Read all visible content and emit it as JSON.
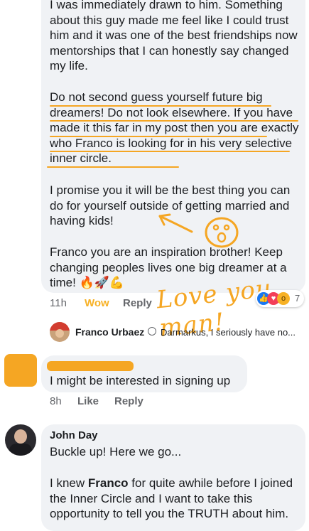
{
  "post_comment": {
    "paragraphs": [
      "I was immediately drawn to him. Something about this guy made me feel like I could trust him and it was one of the best friendships now mentorships that I can honestly say changed my life.",
      "Do not second guess yourself future big dreamers! Do not look elsewhere. If you have made it this far in my post then you are exactly who Franco is looking for in his very selective inner circle.",
      "I promise you it will be the best thing you can do for yourself outside of getting married and having kids!",
      "Franco you are an inspiration brother! Keep changing peoples lives one big dreamer at a time! 🔥🚀💪"
    ],
    "time": "11h",
    "reaction_label": "Wow",
    "reply_label": "Reply",
    "reaction_count": "7",
    "handwritten_annotation": "Love you man!"
  },
  "reply_preview": {
    "author": "Franco Urbaez",
    "text": "Darmarkus, I seriously have no..."
  },
  "comment2": {
    "text": "I might be interested in signing up",
    "time": "8h",
    "like_label": "Like",
    "reply_label": "Reply"
  },
  "comment3": {
    "author": "John Day",
    "line1": "Buckle up! Here we go...",
    "line2_pre": "I knew ",
    "line2_bold": "Franco",
    "line2_post": " for quite awhile before I joined the Inner Circle and I want to take this opportunity to tell you the TRUTH about him."
  },
  "colors": {
    "bubble": "#f0f2f5",
    "annotation": "#f5a623",
    "wow": "#f7b125",
    "meta": "#65676b"
  }
}
